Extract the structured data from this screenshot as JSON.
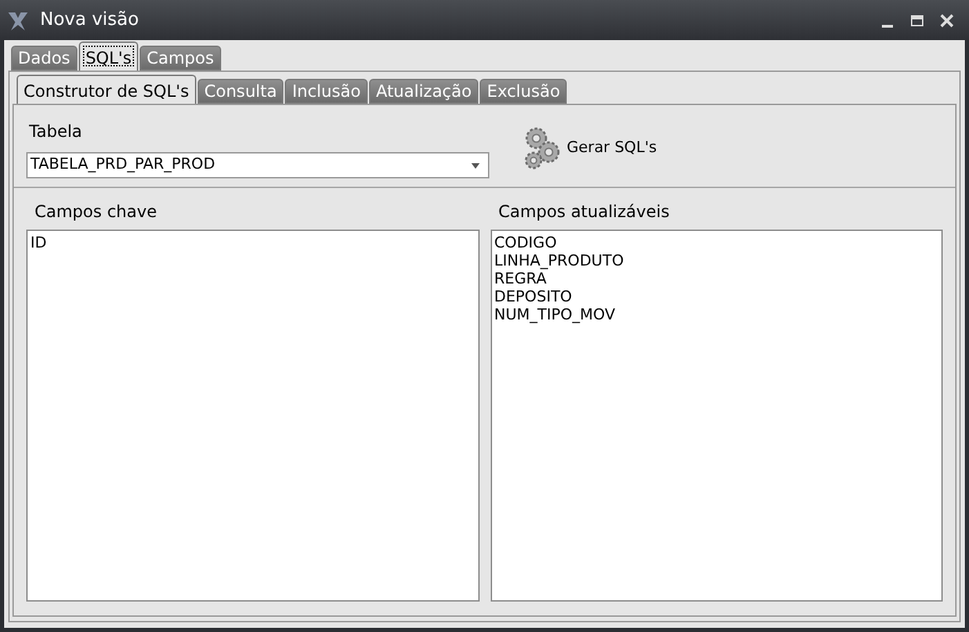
{
  "window": {
    "title": "Nova visão"
  },
  "tabs": [
    {
      "label": "Dados",
      "selected": false
    },
    {
      "label": "SQL's",
      "selected": true
    },
    {
      "label": "Campos",
      "selected": false
    }
  ],
  "sub_tabs": [
    {
      "label": "Construtor de SQL's",
      "selected": true
    },
    {
      "label": "Consulta",
      "selected": false
    },
    {
      "label": "Inclusão",
      "selected": false
    },
    {
      "label": "Atualização",
      "selected": false
    },
    {
      "label": "Exclusão",
      "selected": false
    }
  ],
  "table_field": {
    "label": "Tabela",
    "value": "TABELA_PRD_PAR_PROD"
  },
  "generate_button": {
    "label": "Gerar SQL's"
  },
  "key_fields": {
    "label": "Campos chave",
    "items": [
      "ID"
    ]
  },
  "updatable_fields": {
    "label": "Campos atualizáveis",
    "items": [
      "CODIGO",
      "LINHA_PRODUTO",
      "REGRA",
      "DEPOSITO",
      "NUM_TIPO_MOV"
    ]
  }
}
